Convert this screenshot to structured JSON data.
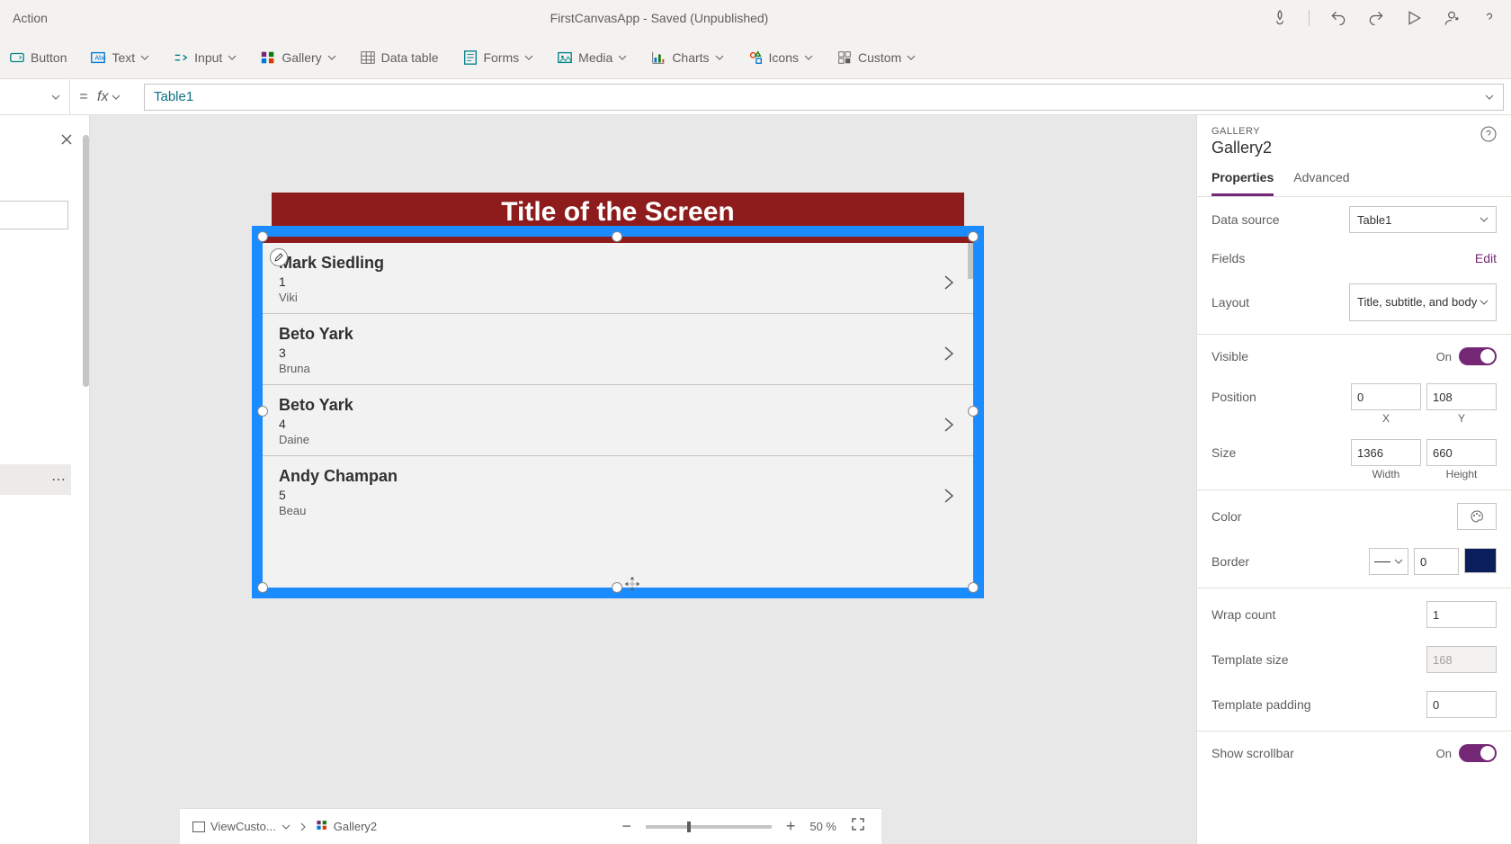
{
  "titlebar": {
    "left": "Action",
    "center": "FirstCanvasApp - Saved (Unpublished)"
  },
  "ribbon": {
    "button": "Button",
    "text": "Text",
    "input": "Input",
    "gallery": "Gallery",
    "datatable": "Data table",
    "forms": "Forms",
    "media": "Media",
    "charts": "Charts",
    "icons": "Icons",
    "custom": "Custom"
  },
  "formula": {
    "eq": "=",
    "fx": "fx",
    "value": "Table1"
  },
  "canvas": {
    "screen_title": "Title of the Screen",
    "items": [
      {
        "title": "Mark Siedling",
        "sub": "1",
        "body": "Viki"
      },
      {
        "title": "Beto Yark",
        "sub": "3",
        "body": "Bruna"
      },
      {
        "title": "Beto Yark",
        "sub": "4",
        "body": "Daine"
      },
      {
        "title": "Andy Champan",
        "sub": "5",
        "body": "Beau"
      }
    ]
  },
  "props": {
    "type_label": "GALLERY",
    "name": "Gallery2",
    "tab_properties": "Properties",
    "tab_advanced": "Advanced",
    "data_source_label": "Data source",
    "data_source_value": "Table1",
    "fields_label": "Fields",
    "fields_edit": "Edit",
    "layout_label": "Layout",
    "layout_value": "Title, subtitle, and body",
    "visible_label": "Visible",
    "visible_on": "On",
    "position_label": "Position",
    "pos_x": "0",
    "pos_y": "108",
    "pos_x_l": "X",
    "pos_y_l": "Y",
    "size_label": "Size",
    "size_w": "1366",
    "size_h": "660",
    "size_w_l": "Width",
    "size_h_l": "Height",
    "color_label": "Color",
    "border_label": "Border",
    "border_width": "0",
    "wrap_label": "Wrap count",
    "wrap_value": "1",
    "tplsize_label": "Template size",
    "tplsize_value": "168",
    "tplpad_label": "Template padding",
    "tplpad_value": "0",
    "scrollbar_label": "Show scrollbar",
    "scrollbar_on": "On"
  },
  "footer": {
    "crumb1": "ViewCusto...",
    "crumb2": "Gallery2",
    "zoom": "50 %"
  }
}
